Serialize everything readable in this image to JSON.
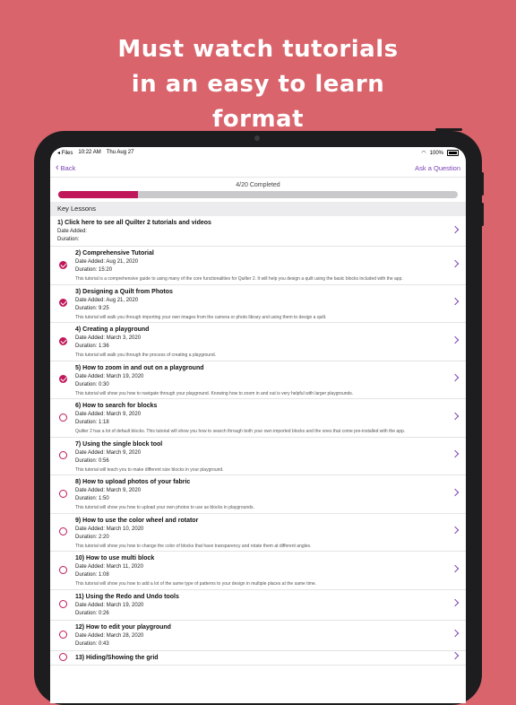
{
  "headline": [
    "Must watch tutorials",
    "in an easy to learn",
    "format"
  ],
  "status": {
    "app": "Files",
    "time": "10:22 AM",
    "date": "Thu Aug 27",
    "battery": "100%"
  },
  "nav": {
    "back_label": "Back",
    "ask_label": "Ask a Question"
  },
  "progress": {
    "text": "4/20 Completed",
    "fraction": 0.2
  },
  "section": {
    "title": "Key Lessons"
  },
  "lessons": [
    {
      "title": "1) Click here to see all Quilter 2 tutorials and videos",
      "date": "Date Added:",
      "duration": "Duration:",
      "desc": "",
      "checked": null
    },
    {
      "title": "2) Comprehensive Tutorial",
      "date": "Date Added: Aug 21, 2020",
      "duration": "Duration: 15:20",
      "desc": "This tutorial is a comprehensive guide to using many of the core functionalities for Quilter 2. It will help you design a quilt using the basic blocks included with the app.",
      "checked": true
    },
    {
      "title": "3) Designing a Quilt from Photos",
      "date": "Date Added: Aug 21, 2020",
      "duration": "Duration: 9:25",
      "desc": "This tutorial will walk you through importing your own images from the camera or photo library and using them to design a quilt.",
      "checked": true
    },
    {
      "title": "4) Creating a playground",
      "date": "Date Added: March 3, 2020",
      "duration": "Duration: 1:36",
      "desc": "This tutorial will walk you through the process of creating a playground.",
      "checked": true
    },
    {
      "title": "5) How to zoom in and out on a playground",
      "date": "Date Added: March 19, 2020",
      "duration": "Duration: 0:30",
      "desc": "This tutorial will show you how to navigate through your playground. Knowing how to zoom in and out is very helpful with larger playgrounds.",
      "checked": true
    },
    {
      "title": "6) How to search for blocks",
      "date": "Date Added: March 9, 2020",
      "duration": "Duration: 1:18",
      "desc": "Quilter 2 has a lot of default blocks. This tutorial will show you how to search through both your own imported blocks and the ones that come pre-installed with the app.",
      "checked": false
    },
    {
      "title": "7) Using the single block tool",
      "date": "Date Added: March 9, 2020",
      "duration": "Duration: 0:56",
      "desc": "This tutorial will teach you to make different size blocks in your playground.",
      "checked": false
    },
    {
      "title": "8) How to upload photos of your fabric",
      "date": "Date Added: March 9, 2020",
      "duration": "Duration: 1:50",
      "desc": "This tutorial will show you how to upload your own photos to use as blocks in playgrounds.",
      "checked": false
    },
    {
      "title": "9) How to use the color wheel and rotator",
      "date": "Date Added: March 10, 2020",
      "duration": "Duration: 2:20",
      "desc": "This tutorial will show you how to change the color of blocks that have transparency and rotate them at different angles.",
      "checked": false
    },
    {
      "title": "10) How to use multi block",
      "date": "Date Added: March 11, 2020",
      "duration": "Duration: 1:08",
      "desc": "This tutorial will show you how to add a lot of the same type of patterns to your design in multiple places at the same time.",
      "checked": false
    },
    {
      "title": "11) Using the Redo and Undo tools",
      "date": "Date Added: March 19, 2020",
      "duration": "Duration: 0:26",
      "desc": "",
      "checked": false
    },
    {
      "title": "12) How to edit your playground",
      "date": "Date Added: March 28, 2020",
      "duration": "Duration: 0:43",
      "desc": "",
      "checked": false
    },
    {
      "title": "13) Hiding/Showing the grid",
      "date": "",
      "duration": "",
      "desc": "",
      "checked": false
    }
  ],
  "colors": {
    "background": "#d9646c",
    "accent": "#c0185a",
    "link": "#7a3fb5"
  }
}
